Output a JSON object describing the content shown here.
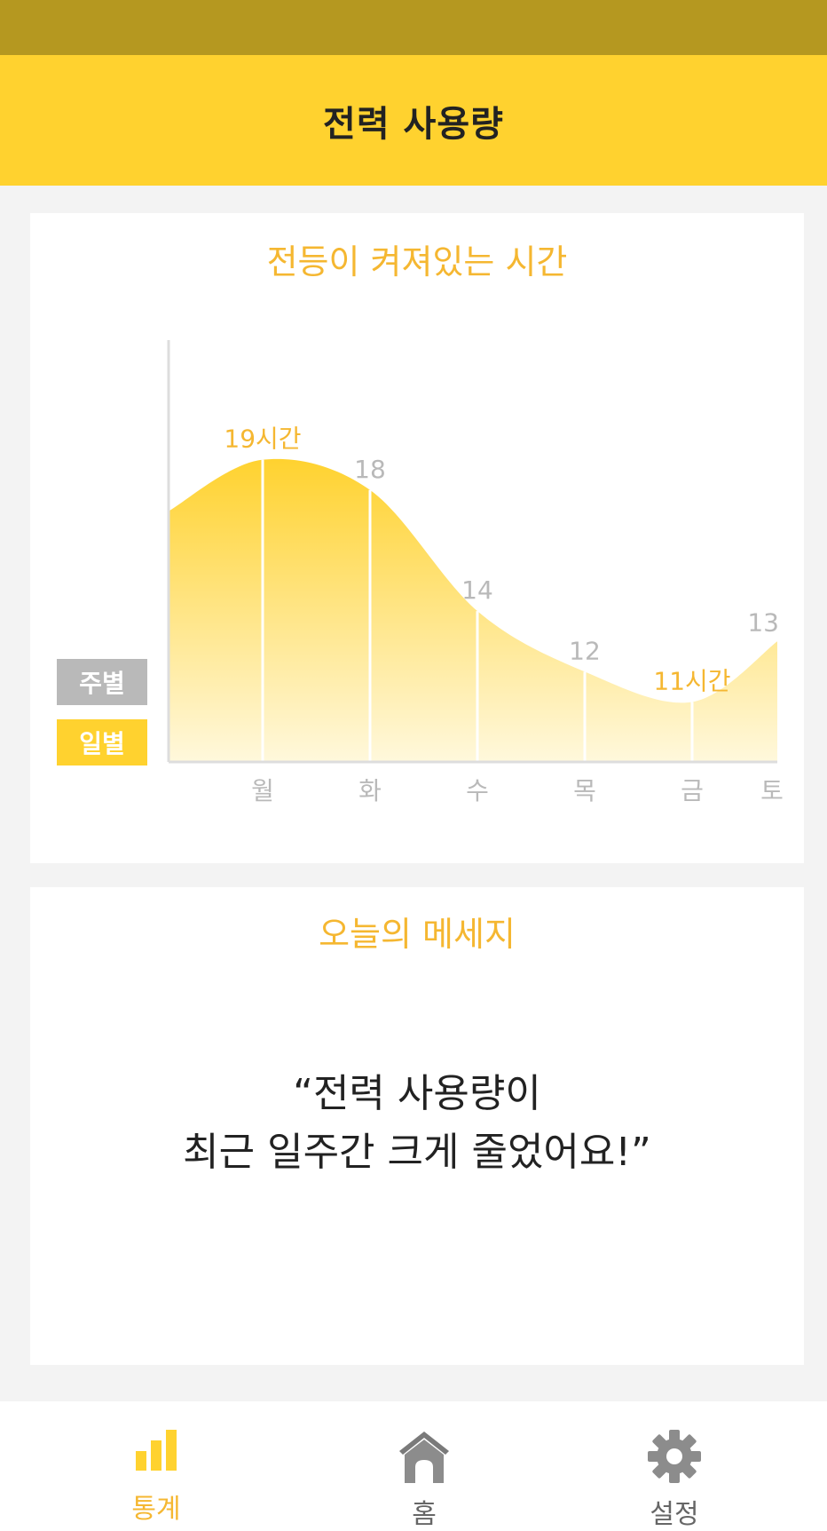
{
  "header": {
    "title": "전력 사용량"
  },
  "chart_card": {
    "title": "전등이 켜져있는 시간",
    "toggle_week": "주별",
    "toggle_day": "일별"
  },
  "chart_data": {
    "type": "area",
    "title": "전등이 켜져있는 시간",
    "categories": [
      "월",
      "화",
      "수",
      "목",
      "금",
      "토"
    ],
    "values": [
      19,
      18,
      14,
      12,
      11,
      13
    ],
    "data_labels": [
      "19시간",
      "18",
      "14",
      "12",
      "11시간",
      "13"
    ],
    "highlight_indices": [
      0,
      4
    ],
    "start_value": 17.3,
    "colors": {
      "fill_top": "#ffd22f",
      "fill_bottom": "#fff8dc",
      "highlight_label": "#f5b731",
      "label": "#b9b9b9",
      "axis": "#dddddd"
    }
  },
  "message_card": {
    "title": "오늘의 메세지",
    "line1": "“전력 사용량이",
    "line2": "최근 일주간 크게 줄었어요!”"
  },
  "bottom_nav": {
    "items": [
      {
        "label": "통계",
        "icon": "bar-chart-icon",
        "active": true
      },
      {
        "label": "홈",
        "icon": "home-icon",
        "active": false
      },
      {
        "label": "설정",
        "icon": "gear-icon",
        "active": false
      }
    ],
    "active_color": "#f5b731",
    "inactive_color": "#777777"
  },
  "colors": {
    "status_bar": "#b59820",
    "header": "#ffd22f",
    "accent": "#f5b731",
    "background": "#f3f3f3"
  }
}
